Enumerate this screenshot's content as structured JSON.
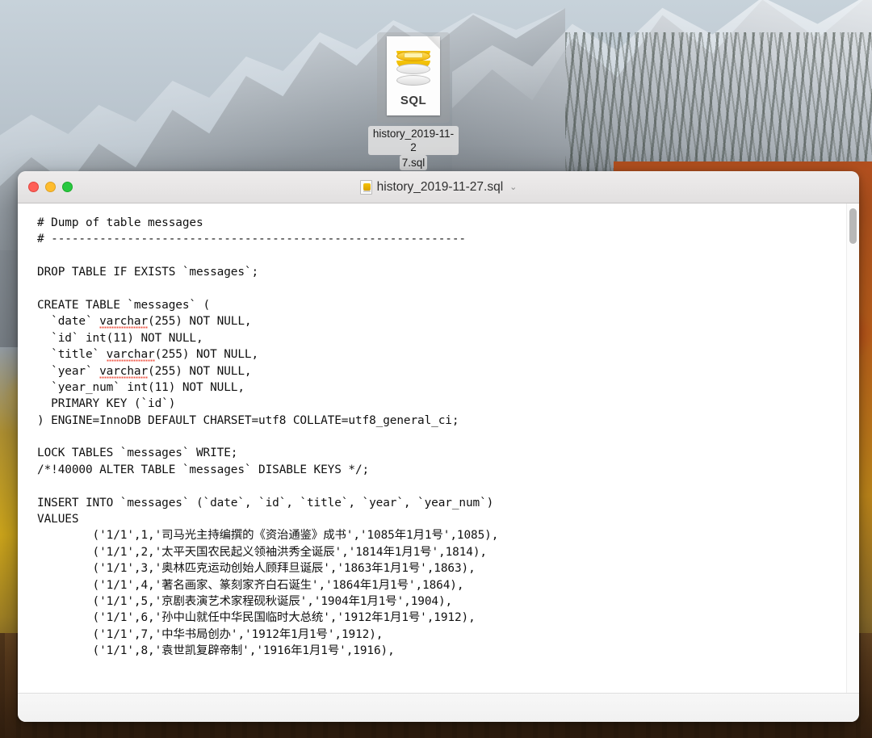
{
  "desktop": {
    "icon": {
      "type_label": "SQL",
      "filename_line1": "history_2019-11-2",
      "filename_line2": "7.sql"
    }
  },
  "window": {
    "title": "history_2019-11-27.sql",
    "title_chevron": "⌄",
    "traffic_lights": {
      "close": "close-button",
      "minimize": "minimize-button",
      "zoom": "zoom-button",
      "close_color": "#ff5f57",
      "minimize_color": "#febc2e",
      "zoom_color": "#28c840"
    }
  },
  "document": {
    "lines": [
      "# Dump of table messages",
      "# ------------------------------------------------------------",
      "",
      "DROP TABLE IF EXISTS `messages`;",
      "",
      "CREATE TABLE `messages` (",
      "  `date` varchar(255) NOT NULL,",
      "  `id` int(11) NOT NULL,",
      "  `title` varchar(255) NOT NULL,",
      "  `year` varchar(255) NOT NULL,",
      "  `year_num` int(11) NOT NULL,",
      "  PRIMARY KEY (`id`)",
      ") ENGINE=InnoDB DEFAULT CHARSET=utf8 COLLATE=utf8_general_ci;",
      "",
      "LOCK TABLES `messages` WRITE;",
      "/*!40000 ALTER TABLE `messages` DISABLE KEYS */;",
      "",
      "INSERT INTO `messages` (`date`, `id`, `title`, `year`, `year_num`)",
      "VALUES",
      "        ('1/1',1,'司马光主持编撰的《资治通鉴》成书','1085年1月1号',1085),",
      "        ('1/1',2,'太平天国农民起义领袖洪秀全诞辰','1814年1月1号',1814),",
      "        ('1/1',3,'奥林匹克运动创始人顾拜旦诞辰','1863年1月1号',1863),",
      "        ('1/1',4,'著名画家、篆刻家齐白石诞生','1864年1月1号',1864),",
      "        ('1/1',5,'京剧表演艺术家程砚秋诞辰','1904年1月1号',1904),",
      "        ('1/1',6,'孙中山就任中华民国临时大总统','1912年1月1号',1912),",
      "        ('1/1',7,'中华书局创办','1912年1月1号',1912),",
      "        ('1/1',8,'袁世凯复辟帝制','1916年1月1号',1916),"
    ],
    "spellcheck_word": "varchar",
    "spellcheck_color": "#f05a4a"
  }
}
